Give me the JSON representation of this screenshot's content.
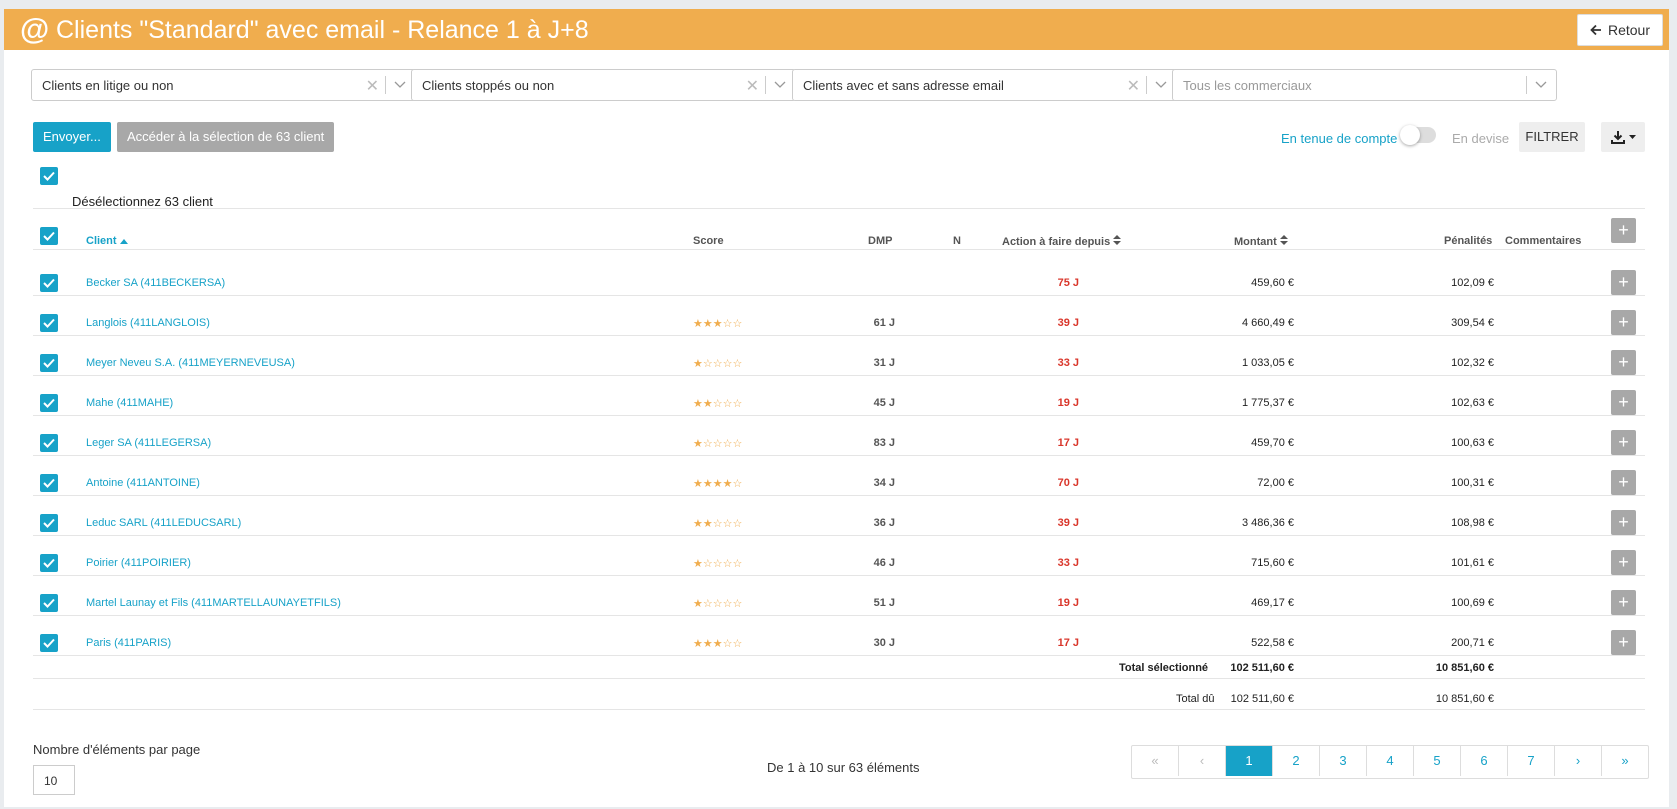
{
  "header": {
    "icon": "at-icon",
    "title": "Clients \"Standard\" avec email - Relance 1 à J+8",
    "back_label": "Retour"
  },
  "filters": [
    {
      "value": "Clients en litige ou non",
      "placeholder": false
    },
    {
      "value": "Clients stoppés ou non",
      "placeholder": false
    },
    {
      "value": "Clients avec et sans adresse email",
      "placeholder": false
    },
    {
      "value": "Tous les commerciaux",
      "placeholder": true
    }
  ],
  "actions": {
    "envoyer": "Envoyer...",
    "acceder": "Accéder à la sélection de 63 client",
    "tenue_compte": "En tenue de compte",
    "devise": "En devise",
    "filtrer": "FILTRER"
  },
  "deselect_label": "Désélectionnez 63 client",
  "columns": {
    "client": "Client",
    "score": "Score",
    "dmp": "DMP",
    "n": "N",
    "action": "Action à faire depuis",
    "montant": "Montant",
    "penalites": "Pénalités",
    "commentaires": "Commentaires"
  },
  "rows": [
    {
      "client": "Becker SA (411BECKERSA)",
      "score": "",
      "dmp": "",
      "action": "75 J",
      "montant": "459,60 €",
      "penalites": "102,09 €"
    },
    {
      "client": "Langlois (411LANGLOIS)",
      "score": "★★★☆☆",
      "dmp": "61 J",
      "action": "39 J",
      "montant": "4 660,49 €",
      "penalites": "309,54 €"
    },
    {
      "client": "Meyer Neveu S.A. (411MEYERNEVEUSA)",
      "score": "★☆☆☆☆",
      "dmp": "31 J",
      "action": "33 J",
      "montant": "1 033,05 €",
      "penalites": "102,32 €"
    },
    {
      "client": "Mahe (411MAHE)",
      "score": "★★☆☆☆",
      "dmp": "45 J",
      "action": "19 J",
      "montant": "1 775,37 €",
      "penalites": "102,63 €"
    },
    {
      "client": "Leger SA (411LEGERSA)",
      "score": "★☆☆☆☆",
      "dmp": "83 J",
      "action": "17 J",
      "montant": "459,70 €",
      "penalites": "100,63 €"
    },
    {
      "client": "Antoine (411ANTOINE)",
      "score": "★★★★☆",
      "dmp": "34 J",
      "action": "70 J",
      "montant": "72,00 €",
      "penalites": "100,31 €"
    },
    {
      "client": "Leduc SARL (411LEDUCSARL)",
      "score": "★★☆☆☆",
      "dmp": "36 J",
      "action": "39 J",
      "montant": "3 486,36 €",
      "penalites": "108,98 €"
    },
    {
      "client": "Poirier (411POIRIER)",
      "score": "★☆☆☆☆",
      "dmp": "46 J",
      "action": "33 J",
      "montant": "715,60 €",
      "penalites": "101,61 €"
    },
    {
      "client": "Martel Launay et Fils (411MARTELLAUNAYETFILS)",
      "score": "★☆☆☆☆",
      "dmp": "51 J",
      "action": "19 J",
      "montant": "469,17 €",
      "penalites": "100,69 €"
    },
    {
      "client": "Paris (411PARIS)",
      "score": "★★★☆☆",
      "dmp": "30 J",
      "action": "17 J",
      "montant": "522,58 €",
      "penalites": "200,71 €"
    }
  ],
  "totals": {
    "selected_label": "Total sélectionné",
    "selected_montant": "102 511,60 €",
    "selected_penalites": "10 851,60 €",
    "due_label": "Total dû",
    "due_montant": "102 511,60 €",
    "due_penalites": "10 851,60 €"
  },
  "pagination": {
    "per_page_label": "Nombre d'éléments par page",
    "per_page_value": "10",
    "range_text": "De 1 à 10 sur 63 éléments",
    "first": "«",
    "prev": "‹",
    "pages": [
      "1",
      "2",
      "3",
      "4",
      "5",
      "6",
      "7"
    ],
    "next": "›",
    "last": "»",
    "current": "1"
  },
  "colors": {
    "header": "#f0ad4e",
    "accent": "#17a2c8",
    "danger": "#d9362b",
    "disabled_button": "#a8a8a8"
  }
}
